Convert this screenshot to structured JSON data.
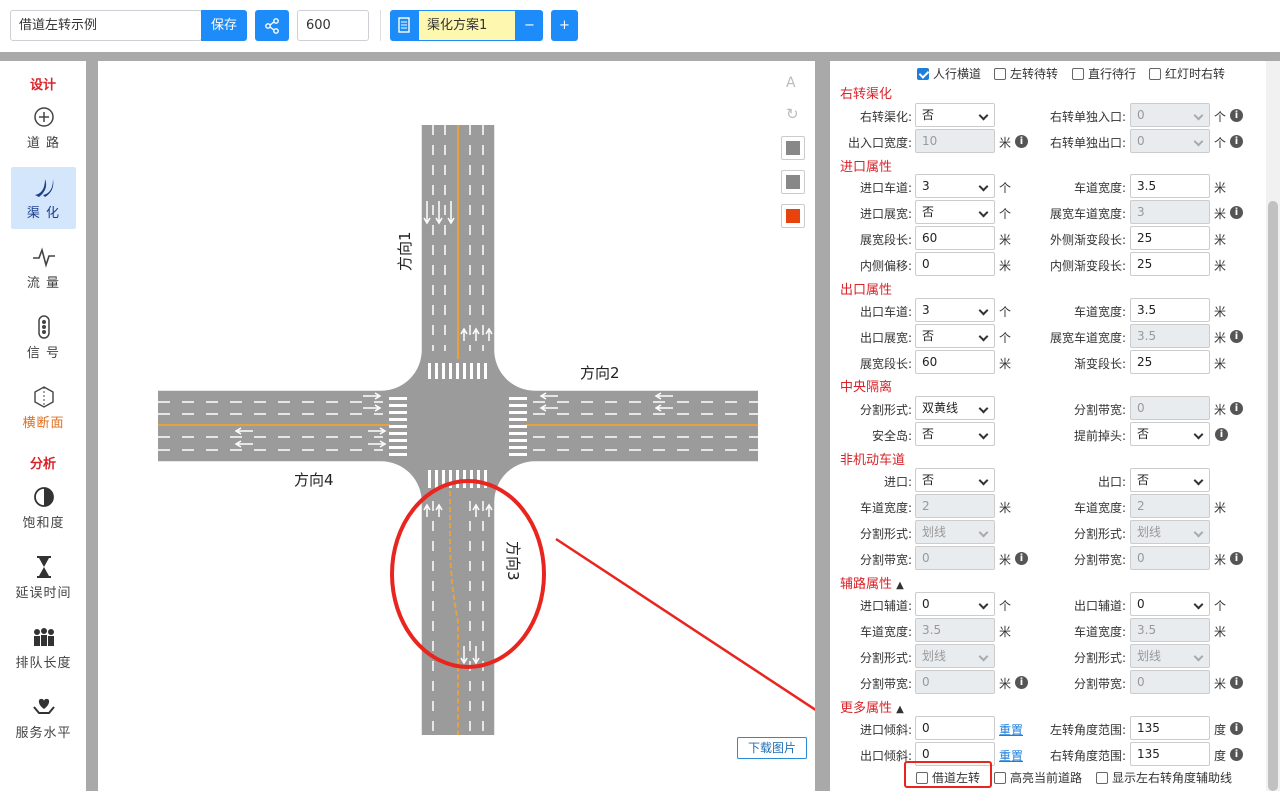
{
  "topbar": {
    "name_value": "借道左转示例",
    "save_label": "保存",
    "number_value": "600",
    "scheme_value": "渠化方案1",
    "minus_label": "−",
    "plus_label": "+"
  },
  "sidebar": {
    "design_title": "设计",
    "analysis_title": "分析",
    "items": [
      {
        "label": "道 路",
        "icon": "crosshair-icon"
      },
      {
        "label": "渠 化",
        "icon": "channel-icon"
      },
      {
        "label": "流 量",
        "icon": "pulse-icon"
      },
      {
        "label": "信 号",
        "icon": "traffic-light-icon"
      },
      {
        "label": "横断面",
        "icon": "cross-section-icon"
      },
      {
        "label": "饱和度",
        "icon": "half-circle-icon"
      },
      {
        "label": "延误时间",
        "icon": "hourglass-icon"
      },
      {
        "label": "排队长度",
        "icon": "queue-icon"
      },
      {
        "label": "服务水平",
        "icon": "heart-hand-icon"
      }
    ]
  },
  "canvas": {
    "direction1": "方向1",
    "direction2": "方向2",
    "direction3": "方向3",
    "direction4": "方向4",
    "download_label": "下载图片"
  },
  "panel": {
    "top_checks": [
      {
        "label": "人行横道",
        "checked": true
      },
      {
        "label": "左转待转",
        "checked": false
      },
      {
        "label": "直行待行",
        "checked": false
      },
      {
        "label": "红灯时右转",
        "checked": false
      }
    ],
    "right_turn": {
      "title": "右转渠化",
      "channel_label": "右转渠化:",
      "channel_value": "否",
      "single_entry_label": "右转单独入口:",
      "single_entry_value": "0",
      "single_entry_unit": "个",
      "width_label": "出入口宽度:",
      "width_value": "10",
      "width_unit": "米",
      "single_exit_label": "右转单独出口:",
      "single_exit_value": "0",
      "single_exit_unit": "个"
    },
    "entry": {
      "title": "进口属性",
      "lanes_label": "进口车道:",
      "lanes_value": "3",
      "lanes_unit": "个",
      "lane_width_label": "车道宽度:",
      "lane_width_value": "3.5",
      "lane_width_unit": "米",
      "widen_label": "进口展宽:",
      "widen_value": "否",
      "widen_unit": "个",
      "widen_width_label": "展宽车道宽度:",
      "widen_width_value": "3",
      "widen_width_unit": "米",
      "widen_len_label": "展宽段长:",
      "widen_len_value": "60",
      "widen_len_unit": "米",
      "outer_taper_label": "外侧渐变段长:",
      "outer_taper_value": "25",
      "outer_taper_unit": "米",
      "inner_offset_label": "内侧偏移:",
      "inner_offset_value": "0",
      "inner_offset_unit": "米",
      "inner_taper_label": "内侧渐变段长:",
      "inner_taper_value": "25",
      "inner_taper_unit": "米"
    },
    "exit": {
      "title": "出口属性",
      "lanes_label": "出口车道:",
      "lanes_value": "3",
      "lanes_unit": "个",
      "lane_width_label": "车道宽度:",
      "lane_width_value": "3.5",
      "lane_width_unit": "米",
      "widen_label": "出口展宽:",
      "widen_value": "否",
      "widen_unit": "个",
      "widen_width_label": "展宽车道宽度:",
      "widen_width_value": "3.5",
      "widen_width_unit": "米",
      "widen_len_label": "展宽段长:",
      "widen_len_value": "60",
      "widen_len_unit": "米",
      "taper_label": "渐变段长:",
      "taper_value": "25",
      "taper_unit": "米"
    },
    "median": {
      "title": "中央隔离",
      "form_label": "分割形式:",
      "form_value": "双黄线",
      "band_label": "分割带宽:",
      "band_value": "0",
      "band_unit": "米",
      "island_label": "安全岛:",
      "island_value": "否",
      "uturn_label": "提前掉头:",
      "uturn_value": "否"
    },
    "nonmotor": {
      "title": "非机动车道",
      "entry_label": "进口:",
      "entry_value": "否",
      "exit_label": "出口:",
      "exit_value": "否",
      "width1_label": "车道宽度:",
      "width1_value": "2",
      "width1_unit": "米",
      "width2_label": "车道宽度:",
      "width2_value": "2",
      "width2_unit": "米",
      "form1_label": "分割形式:",
      "form1_value": "划线",
      "form2_label": "分割形式:",
      "form2_value": "划线",
      "band1_label": "分割带宽:",
      "band1_value": "0",
      "band1_unit": "米",
      "band2_label": "分割带宽:",
      "band2_value": "0",
      "band2_unit": "米"
    },
    "aux": {
      "title": "辅路属性",
      "entry_label": "进口辅道:",
      "entry_value": "0",
      "entry_unit": "个",
      "exit_label": "出口辅道:",
      "exit_value": "0",
      "exit_unit": "个",
      "width1_label": "车道宽度:",
      "width1_value": "3.5",
      "width1_unit": "米",
      "width2_label": "车道宽度:",
      "width2_value": "3.5",
      "width2_unit": "米",
      "form1_label": "分割形式:",
      "form1_value": "划线",
      "form2_label": "分割形式:",
      "form2_value": "划线",
      "band1_label": "分割带宽:",
      "band1_value": "0",
      "band1_unit": "米",
      "band2_label": "分割带宽:",
      "band2_value": "0",
      "band2_unit": "米"
    },
    "more": {
      "title": "更多属性",
      "entry_tilt_label": "进口倾斜:",
      "entry_tilt_value": "0",
      "reset_label": "重置",
      "left_range_label": "左转角度范围:",
      "left_range_value": "135",
      "left_range_unit": "度",
      "exit_tilt_label": "出口倾斜:",
      "exit_tilt_value": "0",
      "reset2_label": "重置",
      "right_range_label": "右转角度范围:",
      "right_range_value": "135",
      "right_range_unit": "度"
    },
    "bottom_checks": [
      {
        "label": "借道左转",
        "checked": false
      },
      {
        "label": "高亮当前道路",
        "checked": false
      },
      {
        "label": "显示左右转角度辅助线",
        "checked": false
      }
    ]
  },
  "colors": {
    "accent": "#1d8cf8",
    "section_red": "#d9232a",
    "road_gray": "#9b9b9b",
    "center_line": "#e8a23a",
    "annotation_red": "#e8251f"
  }
}
